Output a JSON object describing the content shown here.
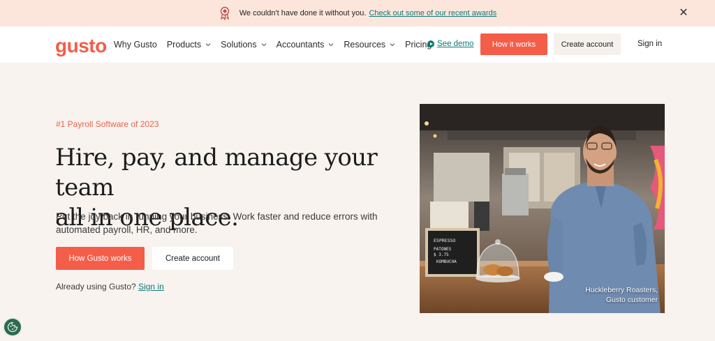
{
  "announcement": {
    "text": "We couldn't have done it without you.",
    "link": "Check out some of our recent awards",
    "icon": "award-ribbon-icon",
    "close_icon": "close-icon"
  },
  "nav": {
    "logo": "gusto",
    "items": [
      {
        "label": "Why Gusto",
        "dropdown": false
      },
      {
        "label": "Products",
        "dropdown": true
      },
      {
        "label": "Solutions",
        "dropdown": true
      },
      {
        "label": "Accountants",
        "dropdown": true
      },
      {
        "label": "Resources",
        "dropdown": true
      },
      {
        "label": "Pricing",
        "dropdown": false
      }
    ],
    "see_demo": "See demo",
    "how_it_works": "How it works",
    "create_account": "Create account",
    "sign_in": "Sign in"
  },
  "hero": {
    "eyebrow": "#1 Payroll Software of 2023",
    "headline_line1": "Hire, pay, and manage your team",
    "headline_line2": "all in one place.",
    "subtext": "Put the joy back in running your business. Work faster and reduce errors with automated payroll, HR, and more.",
    "primary_button": "How Gusto works",
    "secondary_button": "Create account",
    "already_text": "Already using Gusto?",
    "sign_in_link": "Sign in",
    "caption_line1": "Huckleberry Roasters,",
    "caption_line2": "Gusto customer",
    "menu_board": [
      "ESPRESSO",
      "PATONES",
      "$ 3.75",
      "KOMBUCHA"
    ]
  },
  "colors": {
    "brand": "#f45d48",
    "teal_link": "#0a7a78",
    "announce_bg": "#fce6dc",
    "page_bg": "#f8f3ef"
  },
  "cookie_button": {
    "icon": "cookie-icon"
  }
}
